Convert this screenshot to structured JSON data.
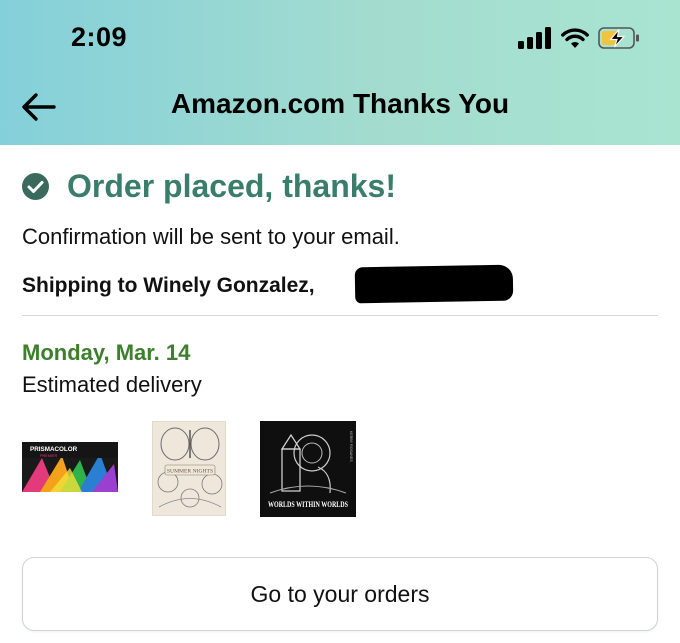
{
  "status_bar": {
    "time": "2:09"
  },
  "header": {
    "title": "Amazon.com Thanks You"
  },
  "confirmation": {
    "title": "Order placed, thanks!",
    "message": "Confirmation will be sent to your email.",
    "shipping_to": "Shipping to Winely Gonzalez,"
  },
  "delivery": {
    "date": "Monday, Mar. 14",
    "label": "Estimated delivery"
  },
  "products": [
    {
      "name": "Prismacolor Premier colored pencils",
      "brand_text": "PRISMACOLOR",
      "sub_text": "PREMIER"
    },
    {
      "name": "Summer Nights coloring book",
      "cover_text": "SUMMER NIGHTS"
    },
    {
      "name": "Worlds Within Worlds coloring book",
      "cover_text": "WORLDS WITHIN WORLDS",
      "author_text": "KERBY ROSANES"
    }
  ],
  "actions": {
    "go_to_orders": "Go to your orders"
  },
  "colors": {
    "header_gradient_start": "#84d0da",
    "header_gradient_end": "#a9e4d1",
    "success_green": "#3a7d6a",
    "delivery_green": "#3d7f2d"
  },
  "icons": [
    "cellular-signal-icon",
    "wifi-icon",
    "battery-charging-icon",
    "back-arrow-icon",
    "check-circle-icon"
  ]
}
